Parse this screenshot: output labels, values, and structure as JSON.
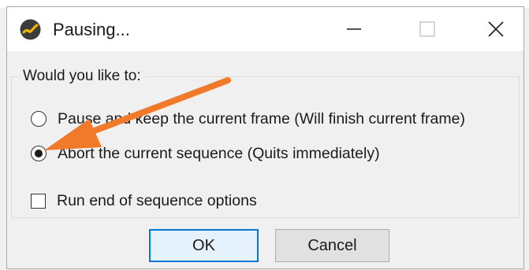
{
  "window": {
    "title": "Pausing...",
    "app_icon": "render-app-icon",
    "controls": [
      "minimize-icon",
      "maximize-icon",
      "close-icon"
    ]
  },
  "dialog": {
    "group_label": "Would you like to:",
    "options": [
      {
        "label": "Pause and keep the current frame (Will finish current frame)",
        "type": "radio",
        "selected": false
      },
      {
        "label": "Abort the current sequence (Quits immediately)",
        "type": "radio",
        "selected": true
      }
    ],
    "checkbox": {
      "label": "Run end of sequence options",
      "checked": false
    },
    "buttons": {
      "ok": "OK",
      "cancel": "Cancel"
    }
  },
  "annotation": {
    "type": "arrow",
    "color": "#f07a2a",
    "points_to": "abort-option"
  },
  "colors": {
    "accent": "#0078d7",
    "ok_button_bg": "#e5f1fb",
    "app_icon_bg": "#3c3c3c",
    "app_icon_swoosh": "#f2b600"
  }
}
